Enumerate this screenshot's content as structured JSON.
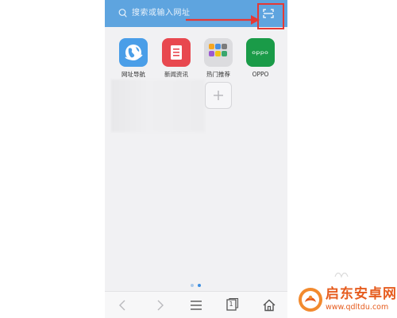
{
  "search": {
    "placeholder": "搜索或输入网址",
    "scan_icon": "scan-icon"
  },
  "apps": [
    {
      "label": "网址导航",
      "icon": "globe-icon",
      "color": "#4a9ee8"
    },
    {
      "label": "新闻资讯",
      "icon": "news-icon",
      "color": "#e8484f"
    },
    {
      "label": "热门推荐",
      "icon": "app-folder-icon",
      "color": "#dcdcdf"
    },
    {
      "label": "OPPO",
      "icon": "oppo-icon",
      "color": "#1a9b48",
      "icon_text": "oppo"
    }
  ],
  "add_tile": {
    "icon": "plus-icon"
  },
  "page_indicator": {
    "total": 2,
    "active": 2
  },
  "bottom_nav": {
    "back_icon": "back-arrow-icon",
    "forward_icon": "forward-arrow-icon",
    "menu_icon": "menu-icon",
    "tabs_icon": "tabs-icon",
    "tabs_count": "1",
    "home_icon": "home-icon"
  },
  "annotation": {
    "arrow_color": "#e53935",
    "box_color": "#e53935"
  },
  "watermark": {
    "title": "启东安卓网",
    "url": "www.qdltdu.com",
    "color": "#e65c1e"
  }
}
